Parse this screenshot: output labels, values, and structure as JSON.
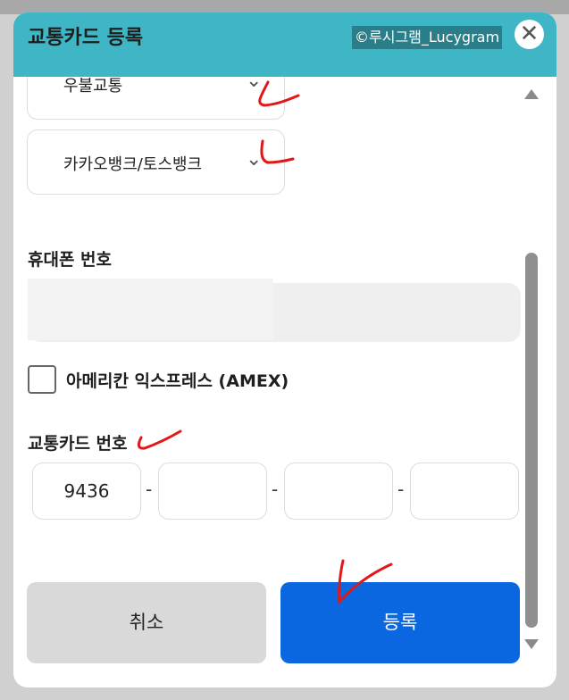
{
  "header": {
    "title": "교통카드 등록",
    "watermark": "©루시그램_Lucygram",
    "close_icon": "close-icon"
  },
  "form": {
    "select_1": "우불교통",
    "select_2": "카카오뱅크/토스뱅크",
    "phone_label": "휴대폰 번호",
    "amex_label": "아메리칸 익스프레스 (AMEX)",
    "card_label": "교통카드 번호",
    "card_parts": [
      "9436",
      "",
      "",
      ""
    ],
    "separator": "-"
  },
  "buttons": {
    "cancel": "취소",
    "register": "등록"
  },
  "colors": {
    "header": "#3fb6c6",
    "primary": "#0b67e0",
    "annotation": "#e01818"
  }
}
